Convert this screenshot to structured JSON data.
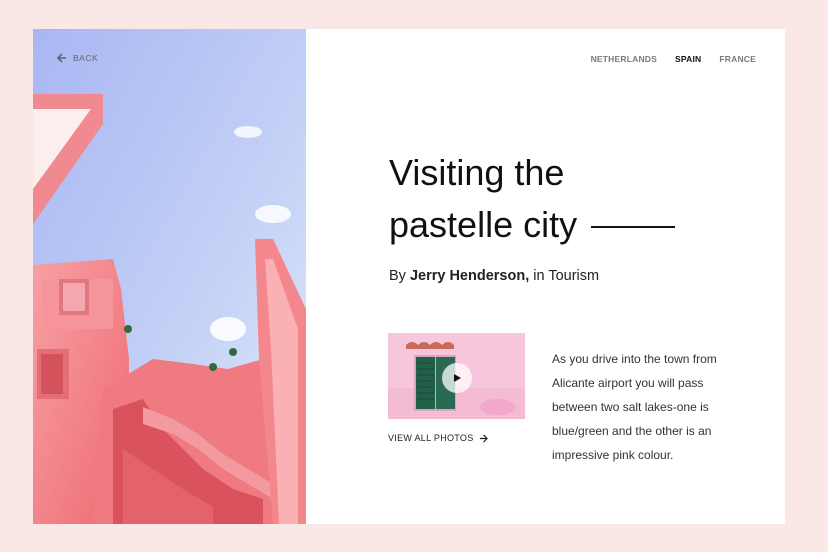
{
  "nav": {
    "back_label": "BACK",
    "items": [
      {
        "label": "NETHERLANDS",
        "active": false
      },
      {
        "label": "SPAIN",
        "active": true
      },
      {
        "label": "FRANCE",
        "active": false
      }
    ]
  },
  "article": {
    "title_line1": "Visiting the",
    "title_line2": "pastelle city",
    "by_prefix": "By",
    "author": "Jerry Henderson,",
    "category_text": "in Tourism",
    "view_all_label": "VIEW ALL PHOTOS",
    "description": "As you drive into the town from Alicante airport you will pass between two salt lakes-one is blue/green and the other is an impressive pink colour."
  },
  "colors": {
    "page_background": "#f9e8e6",
    "card_background": "#ffffff",
    "accent_text": "#111111"
  },
  "icons": {
    "back": "arrow-left-icon",
    "view_all": "arrow-right-icon",
    "play": "play-icon"
  }
}
